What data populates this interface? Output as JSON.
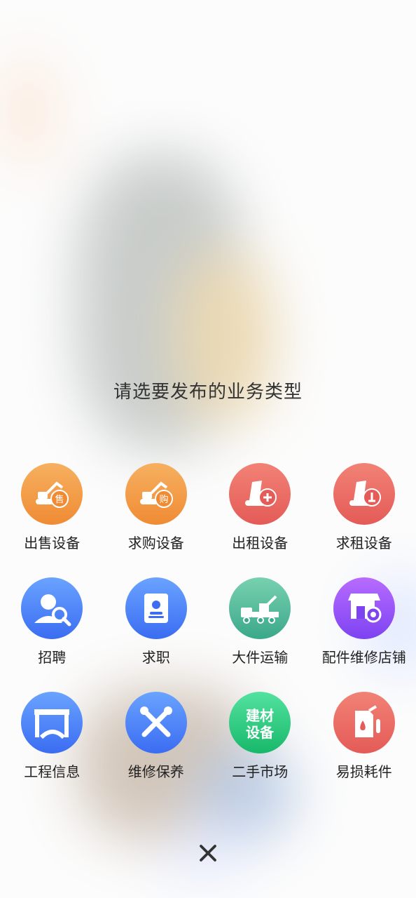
{
  "heading": "请选要发布的业务类型",
  "items": [
    {
      "label": "出售设备"
    },
    {
      "label": "求购设备"
    },
    {
      "label": "出租设备"
    },
    {
      "label": "求租设备"
    },
    {
      "label": "招聘"
    },
    {
      "label": "求职"
    },
    {
      "label": "大件运输"
    },
    {
      "label": "配件维修店铺"
    },
    {
      "label": "工程信息"
    },
    {
      "label": "维修保养"
    },
    {
      "label": "二手市场"
    },
    {
      "label": "易损耗件"
    }
  ],
  "badges": {
    "sell": "售",
    "buy": "购"
  },
  "building_text": {
    "line1": "建材",
    "line2": "设备"
  },
  "icons": [
    "excavator-sell-icon",
    "excavator-buy-icon",
    "excavator-rent-icon",
    "excavator-want-rent-icon",
    "recruit-icon",
    "resume-icon",
    "truck-transport-icon",
    "shop-gear-icon",
    "bridge-road-icon",
    "tools-icon",
    "building-materials-icon",
    "oil-can-icon",
    "close-icon"
  ],
  "colors": {
    "orange": "#f08b34",
    "red": "#e45b57",
    "blue": "#3b6cf2",
    "green": "#3ba88a",
    "purple": "#7d43f1",
    "lime": "#18b86a"
  }
}
